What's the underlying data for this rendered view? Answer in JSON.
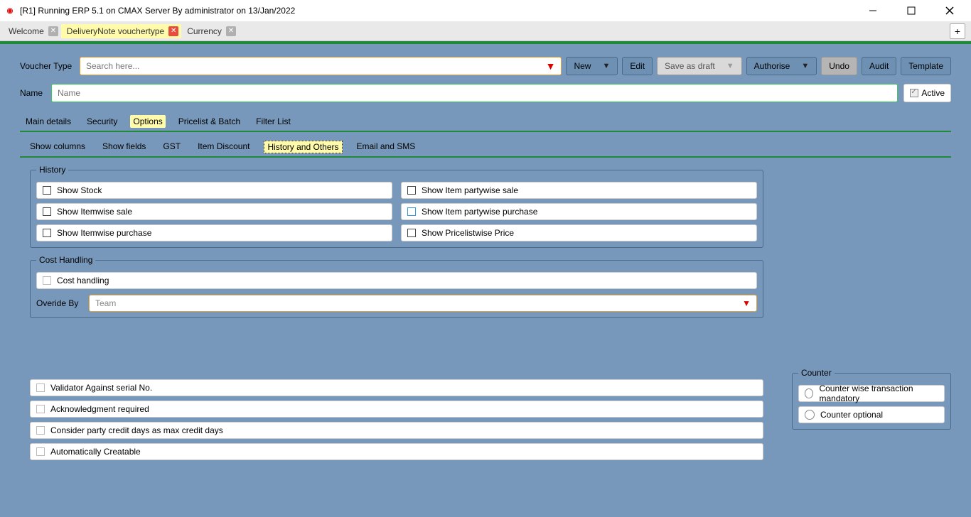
{
  "window": {
    "title": "[R1] Running ERP 5.1 on CMAX Server By administrator on 13/Jan/2022"
  },
  "tabs": {
    "items": [
      {
        "label": "Welcome",
        "active": false
      },
      {
        "label": "DeliveryNote vouchertype",
        "active": true
      },
      {
        "label": "Currency",
        "active": false
      }
    ],
    "add": "+"
  },
  "toolbar": {
    "voucher_type_label": "Voucher Type",
    "search_placeholder": "Search here...",
    "new": "New",
    "edit": "Edit",
    "save_draft": "Save as draft",
    "authorise": "Authorise",
    "undo": "Undo",
    "audit": "Audit",
    "template": "Template"
  },
  "name_row": {
    "label": "Name",
    "placeholder": "Name",
    "active_label": "Active"
  },
  "main_tabs": [
    "Main details",
    "Security",
    "Options",
    "Pricelist & Batch",
    "Filter List"
  ],
  "main_tab_active": 2,
  "option_tabs": [
    "Show columns",
    "Show fields",
    "GST",
    "Item Discount",
    "History and Others",
    "Email and SMS"
  ],
  "option_tab_active": 4,
  "history": {
    "legend": "History",
    "items": [
      "Show Stock",
      "Show Item partywise sale",
      "Show Itemwise sale",
      "Show Item partywise purchase",
      "Show Itemwise purchase",
      "Show Pricelistwise Price"
    ]
  },
  "cost": {
    "legend": "Cost Handling",
    "cost_handling": "Cost handling",
    "override_label": "Overide By",
    "override_value": "Team"
  },
  "counter": {
    "legend": "Counter",
    "opt1": "Counter wise transaction mandatory",
    "opt2": "Counter optional"
  },
  "lower": [
    "Validator Against serial No.",
    "Acknowledgment required",
    "Consider party credit days as max credit days",
    "Automatically Creatable"
  ]
}
